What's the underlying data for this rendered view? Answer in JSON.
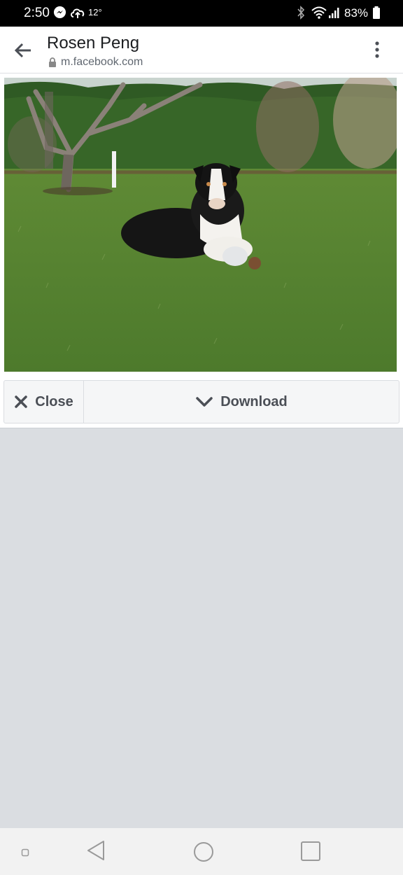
{
  "status_bar": {
    "time": "2:50",
    "temperature": "12°",
    "battery": "83%",
    "icons": [
      "messenger-icon",
      "cloud-upload-icon",
      "bluetooth-icon",
      "wifi-icon",
      "signal-icon",
      "battery-icon"
    ]
  },
  "header": {
    "title": "Rosen Peng",
    "url": "m.facebook.com"
  },
  "photo": {
    "subject": "dog-on-lawn-photo"
  },
  "actions": {
    "close_label": "Close",
    "download_label": "Download"
  },
  "colors": {
    "page_bg": "#dadde1",
    "button_text": "#4b4f56",
    "status_bar": "#000000"
  }
}
